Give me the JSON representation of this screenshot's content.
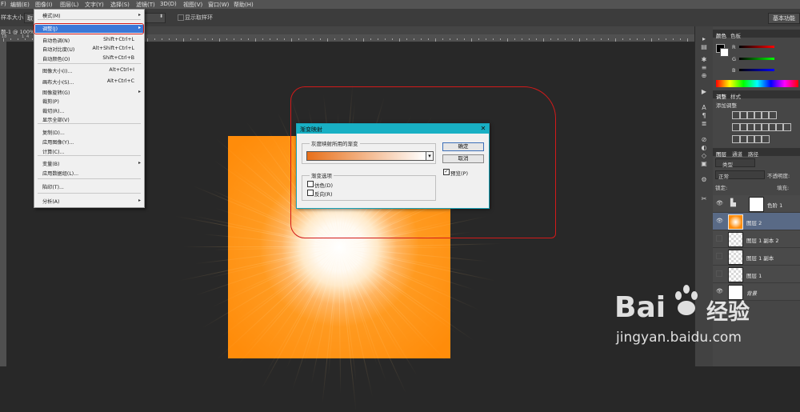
{
  "menubar": {
    "items": [
      "F)",
      "编辑(E)",
      "图像(I)",
      "图层(L)",
      "文字(Y)",
      "选择(S)",
      "滤镜(T)",
      "3D(D)",
      "视图(V)",
      "窗口(W)",
      "帮助(H)"
    ]
  },
  "options_bar": {
    "sample_size_label": "样本大小:",
    "sample_size_value": "取",
    "show_sampling_ring": "显示取样环",
    "workspace_button": "基本功能"
  },
  "document": {
    "tab_title": "题-1 @ 100%",
    "ruler_numbers": [
      "18",
      "1",
      "4"
    ]
  },
  "image_menu": {
    "items": [
      {
        "label": "模式(M)",
        "shortcut": "",
        "submenu": true,
        "disabled": false
      },
      {
        "label": "调整(J)",
        "shortcut": "",
        "submenu": true,
        "disabled": false,
        "highlighted": true
      },
      {
        "label": "自动色调(N)",
        "shortcut": "Shift+Ctrl+L",
        "submenu": false,
        "disabled": false
      },
      {
        "label": "自动对比度(U)",
        "shortcut": "Alt+Shift+Ctrl+L",
        "submenu": false,
        "disabled": false
      },
      {
        "label": "自动颜色(O)",
        "shortcut": "Shift+Ctrl+B",
        "submenu": false,
        "disabled": false
      },
      {
        "label": "图像大小(I)...",
        "shortcut": "Alt+Ctrl+I",
        "submenu": false,
        "disabled": false
      },
      {
        "label": "画布大小(S)...",
        "shortcut": "Alt+Ctrl+C",
        "submenu": false,
        "disabled": false
      },
      {
        "label": "图像旋转(G)",
        "shortcut": "",
        "submenu": true,
        "disabled": false
      },
      {
        "label": "裁剪(P)",
        "shortcut": "",
        "submenu": false,
        "disabled": false
      },
      {
        "label": "裁切(R)...",
        "shortcut": "",
        "submenu": false,
        "disabled": false
      },
      {
        "label": "显示全部(V)",
        "shortcut": "",
        "submenu": false,
        "disabled": false
      },
      {
        "label": "复制(D)...",
        "shortcut": "",
        "submenu": false,
        "disabled": false
      },
      {
        "label": "应用图像(Y)...",
        "shortcut": "",
        "submenu": false,
        "disabled": false
      },
      {
        "label": "计算(C)...",
        "shortcut": "",
        "submenu": false,
        "disabled": false
      },
      {
        "label": "变量(B)",
        "shortcut": "",
        "submenu": true,
        "disabled": false
      },
      {
        "label": "应用数据组(L)...",
        "shortcut": "",
        "submenu": false,
        "disabled": false
      },
      {
        "label": "陷印(T)...",
        "shortcut": "",
        "submenu": false,
        "disabled": false
      },
      {
        "label": "分析(A)",
        "shortcut": "",
        "submenu": true,
        "disabled": false
      }
    ]
  },
  "dialog": {
    "title": "渐变映射",
    "group1_label": "灰度映射所用的渐变",
    "group2_label": "渐变选项",
    "dither_label": "仿色(D)",
    "reverse_label": "反向(R)",
    "ok_label": "确定",
    "cancel_label": "取消",
    "preview_label": "预览(P)",
    "preview_checked": true,
    "dither_checked": false,
    "reverse_checked": false,
    "gradient_start_color": "#e8701a",
    "gradient_end_color": "#ffffff"
  },
  "panels": {
    "color_tabs": [
      "颜色",
      "色板"
    ],
    "color_channels": [
      "R",
      "G",
      "B"
    ],
    "adjust_tabs": [
      "调整",
      "样式"
    ],
    "adjust_hint": "添加调整",
    "layer_tabs": [
      "图层",
      "通道",
      "路径"
    ],
    "kind_filter": "类型",
    "blend_mode": "正常",
    "opacity_label": "不透明度:",
    "opacity_value": "",
    "lock_label": "锁定:",
    "fill_label": "填充:"
  },
  "layers": [
    {
      "name": "色阶 1",
      "visible": true,
      "selected": false,
      "thumb": "adjustment"
    },
    {
      "name": "图层 2",
      "visible": true,
      "selected": true,
      "thumb": "orange"
    },
    {
      "name": "图层 1 副本 2",
      "visible": false,
      "selected": false,
      "thumb": "transparent"
    },
    {
      "name": "图层 1 副本",
      "visible": false,
      "selected": false,
      "thumb": "transparent"
    },
    {
      "name": "图层 1",
      "visible": false,
      "selected": false,
      "thumb": "transparent"
    },
    {
      "name": "背景",
      "visible": true,
      "selected": false,
      "thumb": "white"
    }
  ],
  "watermark": {
    "logo_text": "Bai",
    "logo_text2": "经验",
    "url": "jingyan.baidu.com"
  },
  "colors": {
    "annotation_red": "#d21a1a",
    "dialog_title_bg": "#18b0c4",
    "highlight_blue": "#3a78d8",
    "canvas_orange": "#ff8c0a"
  }
}
